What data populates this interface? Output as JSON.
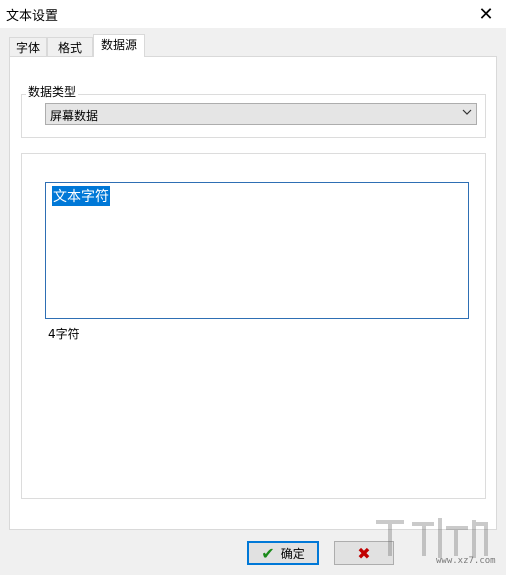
{
  "window": {
    "title": "文本设置",
    "close_icon": "close-icon"
  },
  "tabs": [
    {
      "label": "字体",
      "active": false
    },
    {
      "label": "格式",
      "active": false
    },
    {
      "label": "数据源",
      "active": true
    }
  ],
  "datasource": {
    "group_label": "数据类型",
    "type_value": "屏幕数据",
    "text_value": "文本字符",
    "char_count": "4字符"
  },
  "buttons": {
    "ok_label": "确定"
  },
  "watermark": {
    "url": "www.xz7.com"
  },
  "colors": {
    "accent": "#0078d7",
    "ok_icon": "#1a8a1a",
    "cancel_icon": "#c00000"
  }
}
